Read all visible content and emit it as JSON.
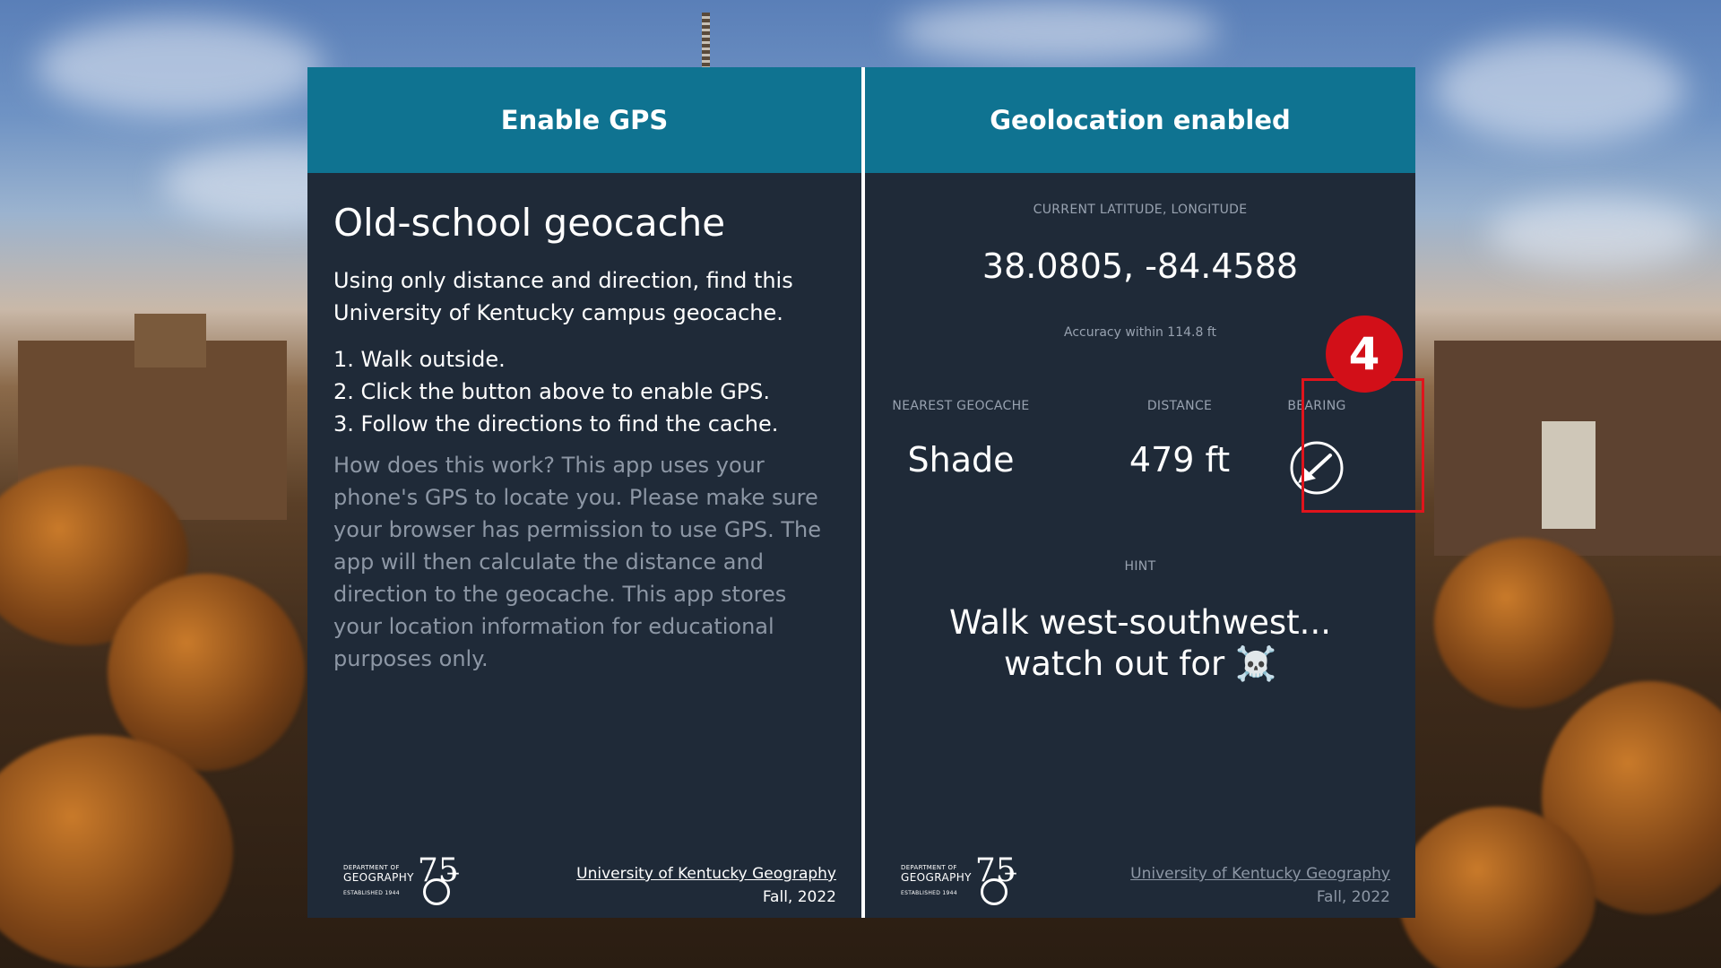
{
  "left_panel": {
    "header_button": "Enable GPS",
    "title": "Old-school geocache",
    "intro": "Using only distance and direction, find this University of Kentucky campus geocache.",
    "steps": [
      "1. Walk outside.",
      "2. Click the button above to enable GPS.",
      "3. Follow the directions to find the cache."
    ],
    "explanation": "How does this work? This app uses your phone's GPS to locate you. Please make sure your browser has permission to use GPS. The app will then calculate the distance and direction to the geocache. This app stores your location information for educational purposes only.",
    "footer": {
      "link": "University of Kentucky Geography",
      "term": "Fall, 2022"
    }
  },
  "right_panel": {
    "header": "Geolocation enabled",
    "coords_label": "CURRENT LATITUDE, LONGITUDE",
    "coords": "38.0805, -84.4588",
    "accuracy": "Accuracy within 114.8 ft",
    "nearest_label": "NEAREST GEOCACHE",
    "nearest_value": "Shade",
    "distance_label": "DISTANCE",
    "distance_value": "479 ft",
    "bearing_label": "BEARING",
    "bearing_icon": "arrow-southwest-icon",
    "hint_label": "HINT",
    "hint_line1": "Walk west-southwest...",
    "hint_line2": "watch out for ☠️",
    "footer": {
      "link": "University of Kentucky Geography",
      "term": "Fall, 2022"
    }
  },
  "logo": {
    "dept": "DEPARTMENT OF",
    "name": "GEOGRAPHY",
    "established": "ESTABLISHED 1944",
    "mark": "75"
  },
  "annotation": {
    "badge": "4",
    "color": "#d20f18"
  },
  "colors": {
    "header": "#0f7391",
    "panel": "#1f2a38",
    "muted": "#8d97a5"
  }
}
